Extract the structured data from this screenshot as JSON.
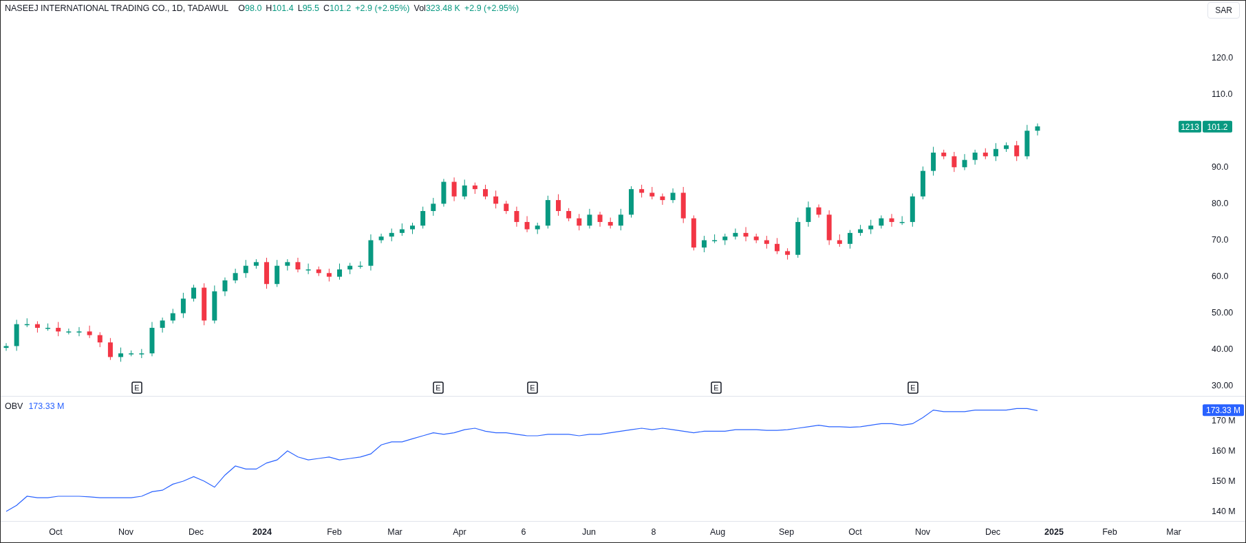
{
  "legend": {
    "title": "NASEEJ INTERNATIONAL TRADING CO., 1D, TADAWUL",
    "ohlc": [
      {
        "label": "O",
        "value": "98.0"
      },
      {
        "label": "H",
        "value": "101.4"
      },
      {
        "label": "L",
        "value": "95.5"
      },
      {
        "label": "C",
        "value": "101.2"
      }
    ],
    "change": "+2.9 (+2.95%)",
    "volume_label": "Vol",
    "volume_value": "323.48 K",
    "volume_change": "+2.9 (+2.95%)"
  },
  "currency_button": "SAR",
  "price_pane": {
    "kind": "picture",
    "countdown_tag": "1213",
    "last_price_tag": "101.2",
    "axis_labels": [
      "120.0",
      "110.0",
      "90.0",
      "80.0",
      "70.0",
      "60.0",
      "50.00",
      "40.00",
      "30.00"
    ],
    "earnings_markers": [
      "E",
      "E",
      "E",
      "E",
      "E"
    ]
  },
  "obv_pane": {
    "kind": "picture",
    "name": "OBV",
    "value": "173.33 M",
    "last_value_tag": "173.33 M",
    "axis_labels": [
      "170 M",
      "160 M",
      "150 M",
      "140 M"
    ]
  },
  "time_axis": {
    "labels": [
      {
        "text": "Oct",
        "major": false
      },
      {
        "text": "Nov",
        "major": false
      },
      {
        "text": "Dec",
        "major": false
      },
      {
        "text": "2024",
        "major": true
      },
      {
        "text": "Feb",
        "major": false
      },
      {
        "text": "Mar",
        "major": false
      },
      {
        "text": "Apr",
        "major": false
      },
      {
        "text": "6",
        "major": false
      },
      {
        "text": "Jun",
        "major": false
      },
      {
        "text": "8",
        "major": false
      },
      {
        "text": "Aug",
        "major": false
      },
      {
        "text": "Sep",
        "major": false
      },
      {
        "text": "Oct",
        "major": false
      },
      {
        "text": "Nov",
        "major": false
      },
      {
        "text": "Dec",
        "major": false
      },
      {
        "text": "2025",
        "major": true
      },
      {
        "text": "Feb",
        "major": false
      },
      {
        "text": "Mar",
        "major": false
      }
    ]
  }
}
